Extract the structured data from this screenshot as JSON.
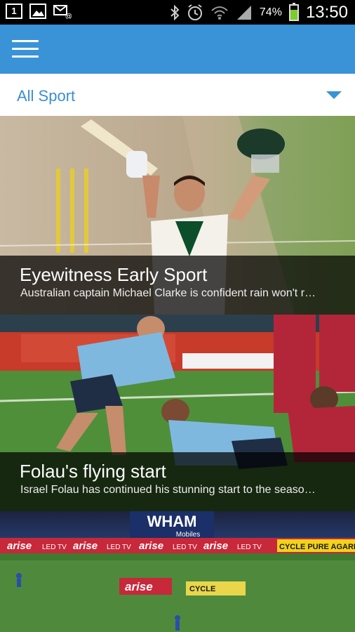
{
  "status_bar": {
    "notification_badge": "1",
    "battery_percent": "74%",
    "time": "13:50",
    "icons": [
      "notification-count-icon",
      "gallery-icon",
      "email-icon",
      "bluetooth-icon",
      "alarm-icon",
      "wifi-icon",
      "signal-icon",
      "battery-icon"
    ]
  },
  "app_bar": {
    "menu_icon": "hamburger-menu-icon",
    "color": "#3a93d6"
  },
  "filter": {
    "selected": "All Sport",
    "caret_icon": "dropdown-caret-icon"
  },
  "articles": [
    {
      "title": "Eyewitness Early Sport",
      "summary": "Australian captain Michael Clarke is confident rain won't r…",
      "image": "cricket-batsman-celebrating-photo"
    },
    {
      "title": "Folau's flying start",
      "summary": "Israel Folau has continued his stunning start to the seaso…",
      "image": "rugby-players-diving-photo"
    },
    {
      "title": "",
      "summary": "",
      "image": "cricket-stadium-field-photo",
      "visible_signage": [
        "WHAM",
        "Mobiles",
        "arise",
        "LED TV",
        "CYCLE PURE AGARBA",
        "CYCLE"
      ]
    }
  ]
}
